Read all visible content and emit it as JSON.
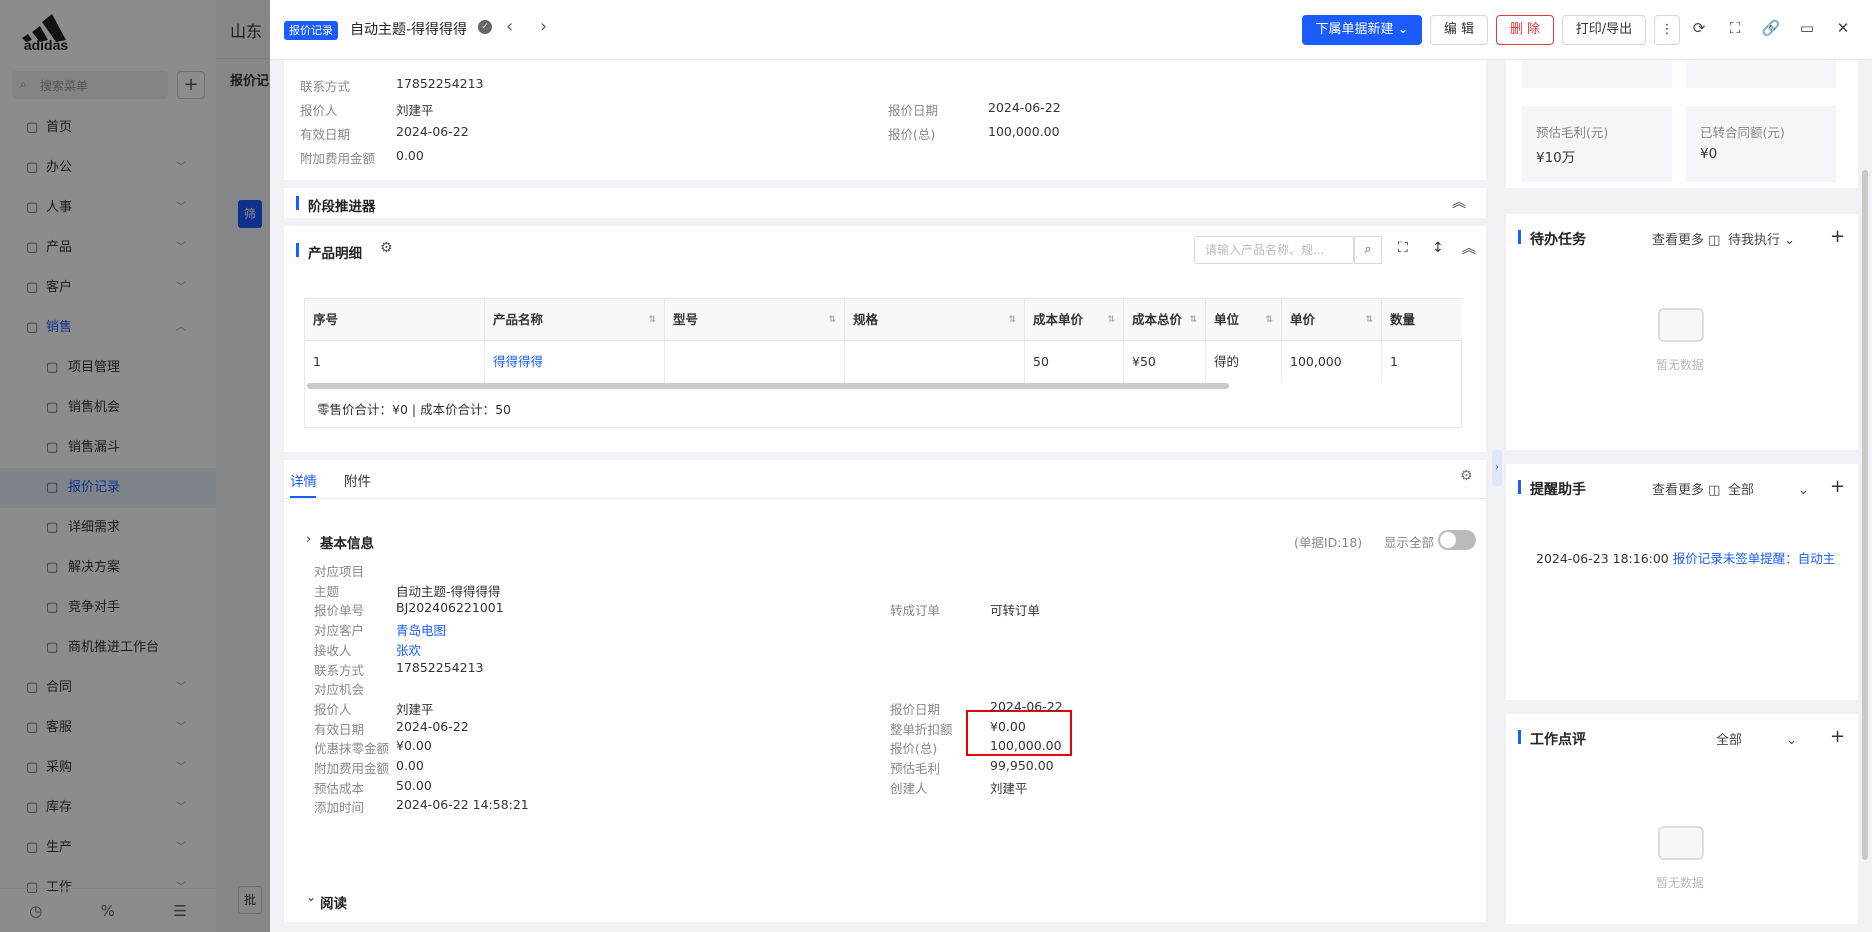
{
  "background": {
    "company": "山东",
    "subtitle": "报价记",
    "search_placeholder": "搜索菜单",
    "menu": [
      {
        "label": "首页",
        "icon": "home-icon"
      },
      {
        "label": "办公",
        "icon": "office-icon"
      },
      {
        "label": "人事",
        "icon": "people-icon"
      },
      {
        "label": "产品",
        "icon": "product-icon"
      },
      {
        "label": "客户",
        "icon": "customer-icon"
      },
      {
        "label": "销售",
        "icon": "sales-icon"
      },
      {
        "label": "项目管理",
        "icon": "project-icon"
      },
      {
        "label": "销售机会",
        "icon": "opportunity-icon"
      },
      {
        "label": "销售漏斗",
        "icon": "funnel-icon"
      },
      {
        "label": "报价记录",
        "icon": "quote-icon"
      },
      {
        "label": "详细需求",
        "icon": "requirement-icon"
      },
      {
        "label": "解决方案",
        "icon": "solution-icon"
      },
      {
        "label": "竞争对手",
        "icon": "competitor-icon"
      },
      {
        "label": "商机推进工作台",
        "icon": "workbench-icon"
      },
      {
        "label": "合同",
        "icon": "contract-icon"
      },
      {
        "label": "客服",
        "icon": "service-icon"
      },
      {
        "label": "采购",
        "icon": "purchase-icon"
      },
      {
        "label": "库存",
        "icon": "inventory-icon"
      },
      {
        "label": "生产",
        "icon": "production-icon"
      },
      {
        "label": "工作",
        "icon": "work-icon"
      }
    ],
    "side_buttons": [
      "筛",
      "批"
    ]
  },
  "drawer": {
    "tag": "报价记录",
    "title": "自动主题-得得得得",
    "buttons": {
      "create_below": "下属单据新建",
      "edit": "编 辑",
      "delete": "删 除",
      "print": "打印/导出"
    },
    "top_info": {
      "contact_label": "联系方式",
      "contact_value": "17852254213",
      "quoter_label": "报价人",
      "quoter_value": "刘建平",
      "quote_date_label": "报价日期",
      "quote_date_value": "2024-06-22",
      "valid_label": "有效日期",
      "valid_value": "2024-06-22",
      "total_label": "报价(总)",
      "total_value": "100,000.00",
      "extra_label": "附加费用金额",
      "extra_value": "0.00"
    },
    "stage_title": "阶段推进器",
    "product": {
      "title": "产品明细",
      "search_placeholder": "请输入产品名称、规...",
      "columns": [
        "序号",
        "产品名称",
        "型号",
        "规格",
        "成本单价",
        "成本总价",
        "单位",
        "单价",
        "数量"
      ],
      "rows": [
        [
          "1",
          "得得得得",
          "",
          "",
          "50",
          "¥50",
          "得的",
          "100,000",
          "1"
        ]
      ],
      "summary": "零售价合计：¥0 |  成本价合计：50"
    },
    "tabs": [
      "详情",
      "附件"
    ],
    "detail": {
      "section_title": "基本信息",
      "doc_id": "(单据ID:18)",
      "show_all": "显示全部",
      "fields_left": [
        {
          "label": "对应项目",
          "value": ""
        },
        {
          "label": "主题",
          "value": "自动主题-得得得得"
        },
        {
          "label": "报价单号",
          "value": "BJ202406221001"
        },
        {
          "label": "对应客户",
          "value": "青岛电图"
        },
        {
          "label": "接收人",
          "value": "张欢"
        },
        {
          "label": "联系方式",
          "value": "17852254213"
        },
        {
          "label": "对应机会",
          "value": ""
        },
        {
          "label": "报价人",
          "value": "刘建平"
        },
        {
          "label": "有效日期",
          "value": "2024-06-22"
        },
        {
          "label": "优惠抹零金额",
          "value": "¥0.00"
        },
        {
          "label": "附加费用金额",
          "value": "0.00"
        },
        {
          "label": "预估成本",
          "value": "50.00"
        },
        {
          "label": "添加时间",
          "value": "2024-06-22 14:58:21"
        }
      ],
      "convert_label": "转成订单",
      "convert_value": "可转订单",
      "fields_right": [
        {
          "label": "报价日期",
          "value": "2024-06-22"
        },
        {
          "label": "整单折扣额",
          "value": "¥0.00"
        },
        {
          "label": "报价(总)",
          "value": "100,000.00"
        },
        {
          "label": "预估毛利",
          "value": "99,950.00"
        },
        {
          "label": "创建人",
          "value": "刘建平"
        }
      ],
      "read_section": "阅读"
    },
    "right_panel": {
      "profit_label": "预估毛利(元)",
      "profit_value": "¥10万",
      "contract_label": "已转合同额(元)",
      "contract_value": "¥0",
      "todo": {
        "title": "待办任务",
        "more": "查看更多",
        "filter": "待我执行",
        "empty": "暂无数据"
      },
      "reminder": {
        "title": "提醒助手",
        "more": "查看更多",
        "filter": "全部",
        "time": "2024-06-23 18:16:00",
        "text": "报价记录未签单提醒：自动主题..."
      },
      "review": {
        "title": "工作点评",
        "filter": "全部",
        "empty": "暂无数据"
      }
    }
  }
}
